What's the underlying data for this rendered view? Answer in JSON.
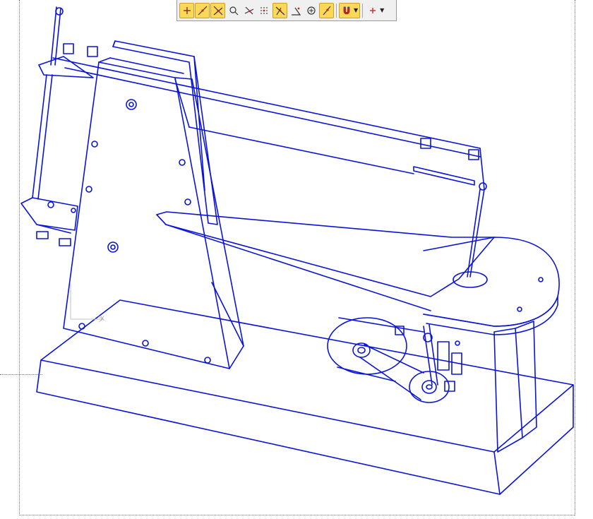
{
  "toolbar": {
    "buttons": [
      {
        "icon": "snap-endpoint-icon",
        "active": true
      },
      {
        "icon": "snap-midpoint-icon",
        "active": true
      },
      {
        "icon": "snap-intersection-icon",
        "active": true
      },
      {
        "icon": "snap-tangent-icon",
        "active": false
      },
      {
        "icon": "snap-apparent-intersection-icon",
        "active": false
      },
      {
        "icon": "snap-grid-icon",
        "active": false
      },
      {
        "icon": "snap-perpendicular-icon",
        "active": true
      },
      {
        "icon": "snap-angle-icon",
        "active": false
      },
      {
        "icon": "snap-center-icon",
        "active": false
      },
      {
        "icon": "snap-on-entity-icon",
        "active": true
      }
    ],
    "magnet_dropdown": {
      "icon": "magnet-icon",
      "active": true
    },
    "point_dropdown": {
      "icon": "point-marker-icon",
      "active": false
    }
  },
  "ucs": {
    "x_label": "X"
  },
  "colors": {
    "wire": "#0a14d8",
    "background": "#ffffff",
    "active_button": "#fbd858"
  }
}
